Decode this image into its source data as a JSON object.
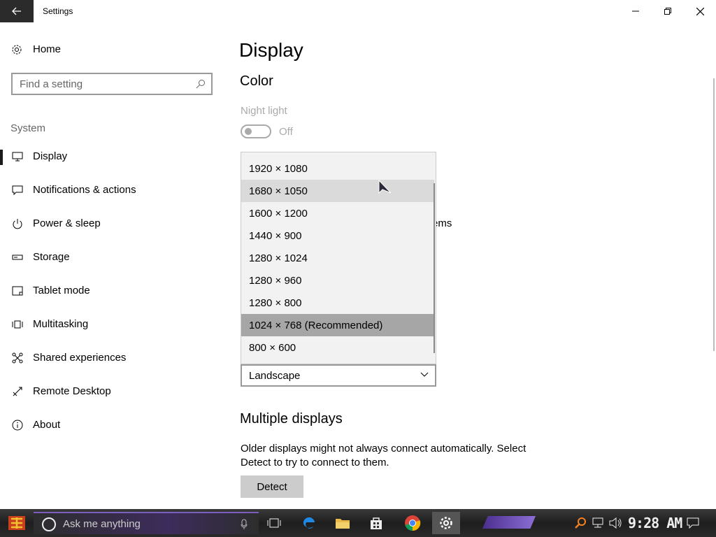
{
  "window": {
    "title": "Settings"
  },
  "sidebar": {
    "home_label": "Home",
    "search_placeholder": "Find a setting",
    "group_label": "System",
    "items": [
      {
        "label": "Display",
        "icon": "monitor-icon",
        "selected": true
      },
      {
        "label": "Notifications & actions",
        "icon": "message-icon"
      },
      {
        "label": "Power & sleep",
        "icon": "power-icon"
      },
      {
        "label": "Storage",
        "icon": "storage-icon"
      },
      {
        "label": "Tablet mode",
        "icon": "tablet-icon"
      },
      {
        "label": "Multitasking",
        "icon": "multitasking-icon"
      },
      {
        "label": "Shared experiences",
        "icon": "shared-icon"
      },
      {
        "label": "Remote Desktop",
        "icon": "remote-desktop-icon"
      },
      {
        "label": "About",
        "icon": "info-icon"
      }
    ]
  },
  "main": {
    "page_title": "Display",
    "color_title": "Color",
    "night_light_label": "Night light",
    "night_light_state": "Off",
    "partial_text": "ems",
    "resolution_options": [
      {
        "label": "1920 × 1080"
      },
      {
        "label": "1680 × 1050",
        "state": "hover"
      },
      {
        "label": "1600 × 1200"
      },
      {
        "label": "1440 × 900"
      },
      {
        "label": "1280 × 1024"
      },
      {
        "label": "1280 × 960"
      },
      {
        "label": "1280 × 800"
      },
      {
        "label": "1024 × 768 (Recommended)",
        "state": "selected"
      },
      {
        "label": "800 × 600"
      }
    ],
    "orientation_value": "Landscape",
    "multiple_displays_title": "Multiple displays",
    "multiple_displays_desc": "Older displays might not always connect automatically. Select Detect to try to connect to them.",
    "detect_label": "Detect"
  },
  "taskbar": {
    "search_placeholder": "Ask me anything",
    "clock": "9:28 AM",
    "accent": "#7a5fbf"
  }
}
